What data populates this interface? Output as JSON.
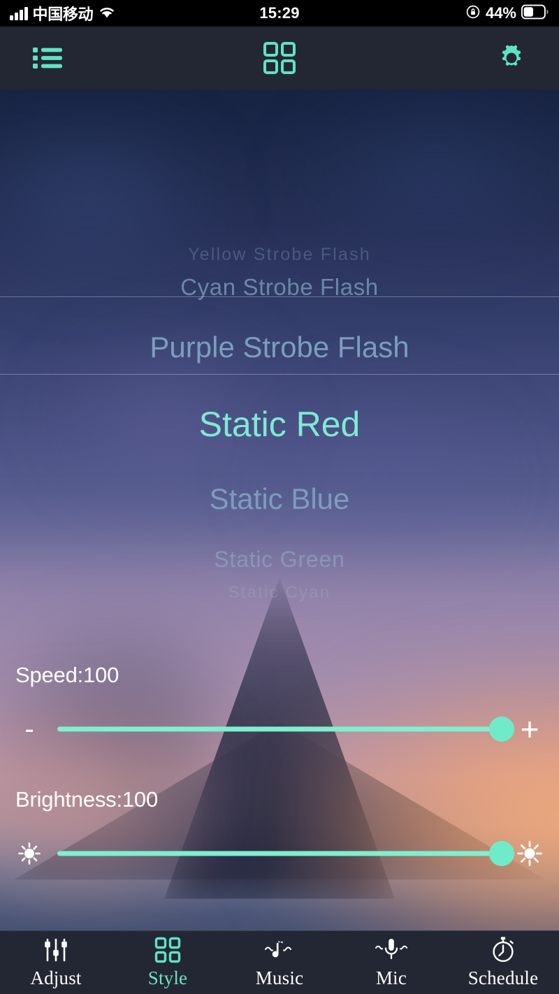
{
  "status_bar": {
    "carrier": "中国移动",
    "signal_icon": "signal-bars-icon",
    "wifi_icon": "wifi-icon",
    "time": "15:29",
    "rotation_lock_icon": "rotation-lock-icon",
    "battery_percent": "44%",
    "battery_level": 44,
    "battery_icon": "battery-icon"
  },
  "header": {
    "list_button": {
      "icon": "list-icon",
      "label": "List"
    },
    "grid_button": {
      "icon": "grid-icon",
      "label": "Style"
    },
    "settings_button": {
      "icon": "gear-icon",
      "label": "Settings"
    }
  },
  "picker": {
    "selected_index": 3,
    "selected_value": "Static Red",
    "items": [
      {
        "label": "Yellow Strobe Flash"
      },
      {
        "label": "Cyan Strobe Flash"
      },
      {
        "label": "Purple Strobe Flash"
      },
      {
        "label": "Static Red"
      },
      {
        "label": "Static Blue"
      },
      {
        "label": "Static Green"
      },
      {
        "label": "Static Cyan"
      }
    ]
  },
  "speed": {
    "label": "Speed:100",
    "value": 100,
    "min": 0,
    "max": 100,
    "decrease_label": "-",
    "increase_label": "+",
    "decrease_icon": "minus-icon",
    "increase_icon": "plus-icon"
  },
  "brightness": {
    "label": "Brightness:100",
    "value": 100,
    "min": 0,
    "max": 100,
    "low_icon": "brightness-low-icon",
    "high_icon": "brightness-high-icon"
  },
  "tabbar": {
    "active": "Style",
    "items": [
      {
        "label": "Adjust",
        "icon": "sliders-icon"
      },
      {
        "label": "Style",
        "icon": "grid-icon"
      },
      {
        "label": "Music",
        "icon": "music-note-icon"
      },
      {
        "label": "Mic",
        "icon": "microphone-icon"
      },
      {
        "label": "Schedule",
        "icon": "stopwatch-icon"
      }
    ]
  },
  "colors": {
    "accent": "#6FE3C2",
    "track": "#7FEFD0",
    "knob": "#6FEBC9",
    "bar_background": "#232733",
    "status_background": "#000000",
    "selected_text": "#7EEAD2"
  }
}
